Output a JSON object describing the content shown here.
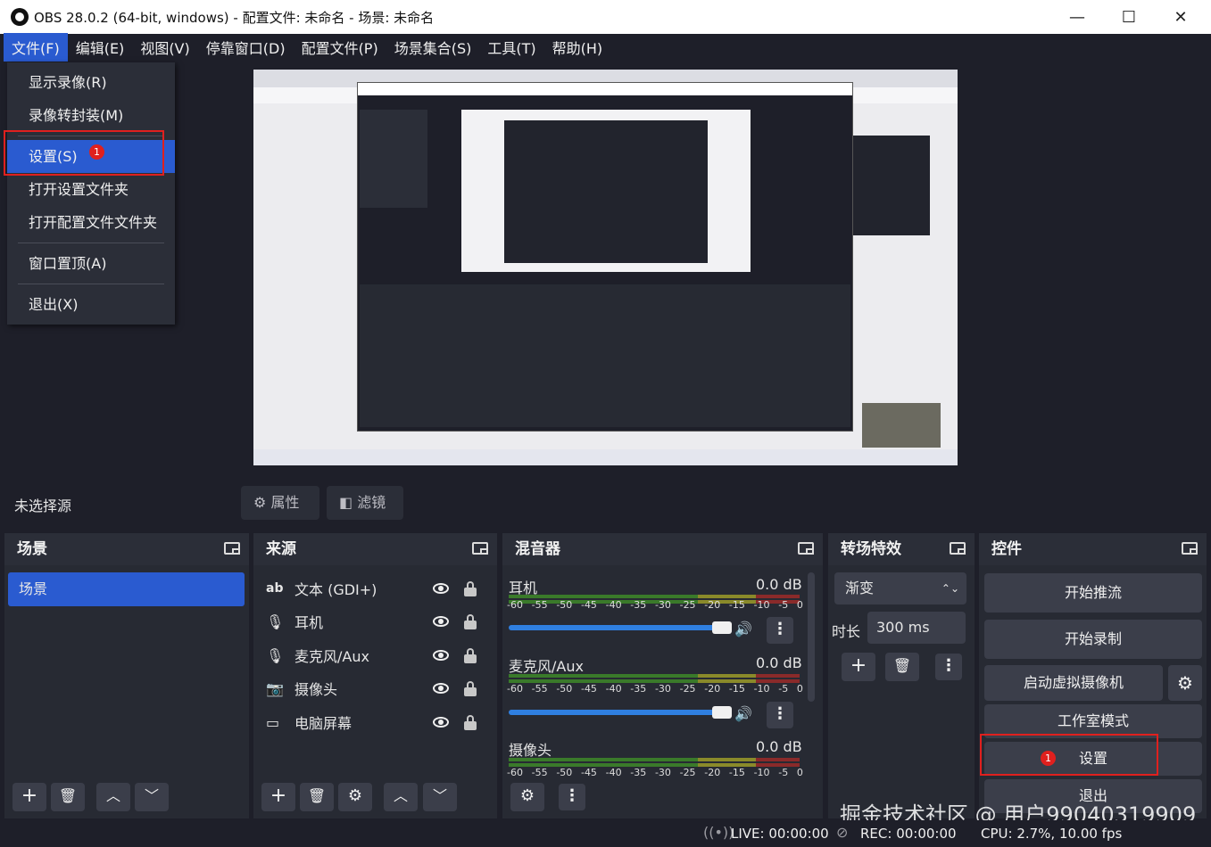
{
  "window": {
    "title": "OBS 28.0.2 (64-bit, windows) - 配置文件: 未命名 - 场景: 未命名",
    "minimize_glyph": "—",
    "maximize_glyph": "☐",
    "close_glyph": "✕"
  },
  "menubar": [
    {
      "label": "文件(F)"
    },
    {
      "label": "编辑(E)"
    },
    {
      "label": "视图(V)"
    },
    {
      "label": "停靠窗口(D)"
    },
    {
      "label": "配置文件(P)"
    },
    {
      "label": "场景集合(S)"
    },
    {
      "label": "工具(T)"
    },
    {
      "label": "帮助(H)"
    }
  ],
  "file_menu": {
    "show_recordings": "显示录像(R)",
    "remux": "录像转封装(M)",
    "settings": "设置(S)",
    "open_settings_folder": "打开设置文件夹",
    "open_profile_folder": "打开配置文件文件夹",
    "always_on_top": "窗口置顶(A)",
    "exit": "退出(X)",
    "annotation_number": "1"
  },
  "source_bar": {
    "no_source": "未选择源",
    "properties": "属性",
    "filters": "滤镜"
  },
  "scenes": {
    "title": "场景",
    "items": [
      "场景"
    ]
  },
  "sources": {
    "title": "来源",
    "items": [
      {
        "label": "文本 (GDI+)",
        "icon": "text-icon"
      },
      {
        "label": "耳机",
        "icon": "microphone-icon"
      },
      {
        "label": "麦克风/Aux",
        "icon": "microphone-icon"
      },
      {
        "label": "摄像头",
        "icon": "camera-icon"
      },
      {
        "label": "电脑屏幕",
        "icon": "monitor-icon"
      }
    ]
  },
  "mixer": {
    "title": "混音器",
    "ticks": [
      "-60",
      "-55",
      "-50",
      "-45",
      "-40",
      "-35",
      "-30",
      "-25",
      "-20",
      "-15",
      "-10",
      "-5",
      "0"
    ],
    "channels": [
      {
        "name": "耳机",
        "db": "0.0 dB"
      },
      {
        "name": "麦克风/Aux",
        "db": "0.0 dB"
      },
      {
        "name": "摄像头",
        "db": "0.0 dB"
      }
    ]
  },
  "transitions": {
    "title": "转场特效",
    "selected": "渐变",
    "duration_label": "时长",
    "duration_value": "300 ms"
  },
  "controls": {
    "title": "控件",
    "start_stream": "开始推流",
    "start_record": "开始录制",
    "virtual_cam": "启动虚拟摄像机",
    "studio_mode": "工作室模式",
    "settings": "设置",
    "exit": "退出",
    "annotation_number": "1"
  },
  "status": {
    "live": "LIVE: 00:00:00",
    "rec": "REC: 00:00:00",
    "cpu": "CPU: 2.7%, 10.00 fps"
  },
  "watermark": "掘金技术社区 @ 用户99040319909",
  "colors": {
    "accent": "#2a5bd0",
    "annotation_red": "#e0201e",
    "background": "#1e1f29",
    "panel": "#272a33"
  }
}
